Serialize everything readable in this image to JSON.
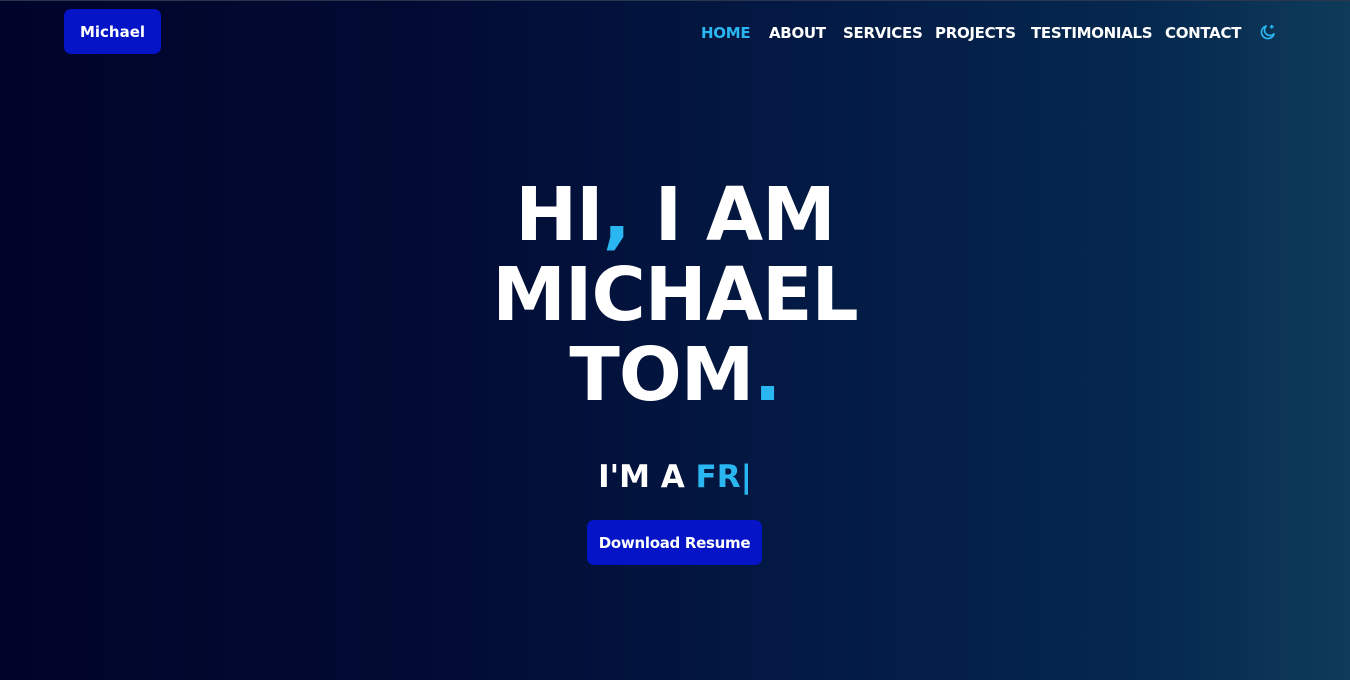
{
  "header": {
    "logo_label": "Michael",
    "nav": [
      {
        "label": "HOME",
        "active": true
      },
      {
        "label": "ABOUT",
        "active": false
      },
      {
        "label": "SERVICES",
        "active": false
      },
      {
        "label": "PROJECTS",
        "active": false
      },
      {
        "label": "TESTIMONIALS",
        "active": false
      },
      {
        "label": "CONTACT",
        "active": false
      }
    ],
    "theme_toggle_icon": "moon-icon"
  },
  "hero": {
    "line1_a": "HI",
    "line1_comma": ",",
    "line1_b": " I AM",
    "line2": "MICHAEL",
    "line3": "TOM",
    "line3_dot": ".",
    "typing_prefix": "I'M A ",
    "typing_text": "FR|"
  },
  "actions": {
    "download_label": "Download Resume"
  },
  "colors": {
    "accent": "#2ab6f0",
    "button": "#0414c6",
    "text": "#ffffff"
  }
}
